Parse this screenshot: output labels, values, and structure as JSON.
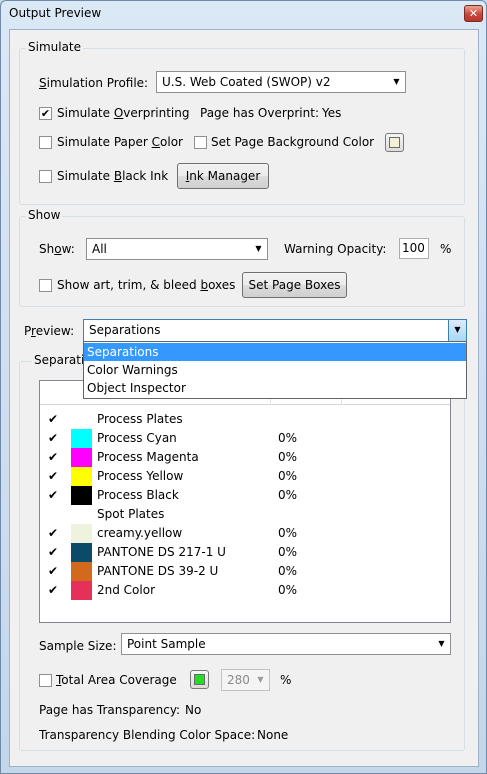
{
  "window": {
    "title": "Output Preview",
    "close_glyph": "✕"
  },
  "simulate": {
    "legend": "Simulate",
    "profile_label_pre": "S",
    "profile_label_post": "imulation Profile:",
    "profile_value": "U.S. Web Coated (SWOP) v2",
    "overprinting": {
      "checked": true,
      "pre": "Simulate ",
      "u": "O",
      "post": "verprinting"
    },
    "page_overprint_label": "Page has Overprint:",
    "page_overprint_value": "Yes",
    "paper_color": {
      "checked": false,
      "pre": "Simulate Paper ",
      "u": "C",
      "post": "olor"
    },
    "page_bg": {
      "checked": false,
      "pre": "Set Page Background Color"
    },
    "black_ink": {
      "checked": false,
      "pre": "Simulate ",
      "u": "B",
      "post": "lack Ink"
    },
    "ink_manager": {
      "u": "I",
      "post": "nk Manager"
    }
  },
  "show": {
    "legend": "Show",
    "show_label_pre": "Sh",
    "show_label_u": "o",
    "show_label_post": "w:",
    "show_value": "All",
    "warning_opacity_label": "Warning Opacity:",
    "warning_opacity_value": "100",
    "percent": "%",
    "boxes": {
      "checked": false,
      "pre": "Show art, trim, & bleed ",
      "u": "b",
      "post": "oxes"
    },
    "set_page_boxes": "Set Page Boxes"
  },
  "preview": {
    "label_pre": "P",
    "label_u": "r",
    "label_post": "eview:",
    "value": "Separations",
    "options": [
      "Separations",
      "Color Warnings",
      "Object Inspector"
    ],
    "selected_index": 0
  },
  "separations": {
    "legend": "Separations",
    "rows": [
      {
        "checked": true,
        "name": "Process Plates",
        "color": "",
        "percent": ""
      },
      {
        "checked": true,
        "name": "Process Cyan",
        "color": "#00ffff",
        "percent": "0%"
      },
      {
        "checked": true,
        "name": "Process Magenta",
        "color": "#ff00ff",
        "percent": "0%"
      },
      {
        "checked": true,
        "name": "Process Yellow",
        "color": "#ffff00",
        "percent": "0%"
      },
      {
        "checked": true,
        "name": "Process Black",
        "color": "#000000",
        "percent": "0%"
      },
      {
        "checked": false,
        "name": "Spot Plates",
        "color": "",
        "percent": ""
      },
      {
        "checked": true,
        "name": "creamy.yellow",
        "color": "#eef3dd",
        "percent": "0%"
      },
      {
        "checked": true,
        "name": "PANTONE DS 217-1 U",
        "color": "#0b4a68",
        "percent": "0%"
      },
      {
        "checked": true,
        "name": "PANTONE DS 39-2 U",
        "color": "#d26a1e",
        "percent": "0%"
      },
      {
        "checked": true,
        "name": "2nd Color",
        "color": "#e5305a",
        "percent": "0%"
      }
    ]
  },
  "sample": {
    "label": "Sample Size:",
    "value": "Point Sample",
    "tac": {
      "checked": false,
      "u": "T",
      "post": "otal Area Coverage"
    },
    "tac_color": "#22dd22",
    "tac_value": "280",
    "percent": "%",
    "transparency_label": "Page has Transparency:",
    "transparency_value": "No",
    "blend_label": "Transparency Blending Color Space:",
    "blend_value": "None"
  },
  "icons": {
    "check": "✔",
    "combo_arrow": "▼"
  },
  "colors": {
    "selection": "#3399ff",
    "page_bg_swatch": "#f3f0d8"
  }
}
